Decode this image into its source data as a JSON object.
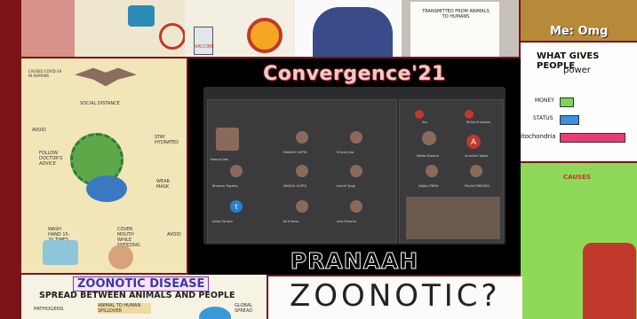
{
  "center": {
    "title": "Convergence'21",
    "footer": "PRANAAH",
    "meeting": {
      "participants_left": [
        "Kaavya Vas",
        "MANSHI GUPTA",
        "Shivani Jha",
        "Bhawna Tripathy",
        "MADHU GUPTA",
        "Ishmit Tyagi",
        "Ishita Tanwar",
        "Kirti Rana",
        "Isha Sharma"
      ],
      "participants_right": [
        "You",
        "Ritika Srivastav",
        "Nikita Sharma",
        "Anushka Yadav",
        "ANJALI PRIYA",
        "PALAK DWIVEDI"
      ],
      "right_avatar_letters": [
        "t",
        "A"
      ]
    }
  },
  "posters": {
    "top_middle_heading": "TRANSMITTED FROM ANIMALS TO HUMANS",
    "top_left_label": "VACCINE",
    "meme_caption": "Me: Omg",
    "power_chart": {
      "title": "WHAT GIVES PEOPLE",
      "subtitle": "power",
      "rows": [
        "MONEY",
        "STATUS",
        "itochondria"
      ]
    },
    "left_poster": {
      "labels": [
        "CAUSED COVID-19 IN HUMANS",
        "SOCIAL DISTANCE",
        "AVOID",
        "STAY HYDRATED",
        "FOLLOW DOCTOR'S ADVICE",
        "WEAR MASK",
        "WASH HAND 15-20 TIMES PER DAY",
        "COVER MOUTH WHILE SNEEZING",
        "AVOID"
      ]
    },
    "bottom_left": {
      "title": "ZOONOTIC DISEASE",
      "subtitle": "SPREAD BETWEEN ANIMALS AND PEOPLE",
      "tags": [
        "PATHOGENS",
        "ANIMAL TO HUMAN SPILLOVER",
        "GLOBAL SPREAD"
      ]
    },
    "bottom_middle": {
      "title": "ZOONOTIC?"
    },
    "right_green": {
      "heading": "CAUSES"
    }
  },
  "colors": {
    "background": "#7a1418",
    "title": "#f4c7c7",
    "chart_money": "#7fd35a",
    "chart_status": "#3b8fe0",
    "chart_mito": "#e93a7a"
  }
}
